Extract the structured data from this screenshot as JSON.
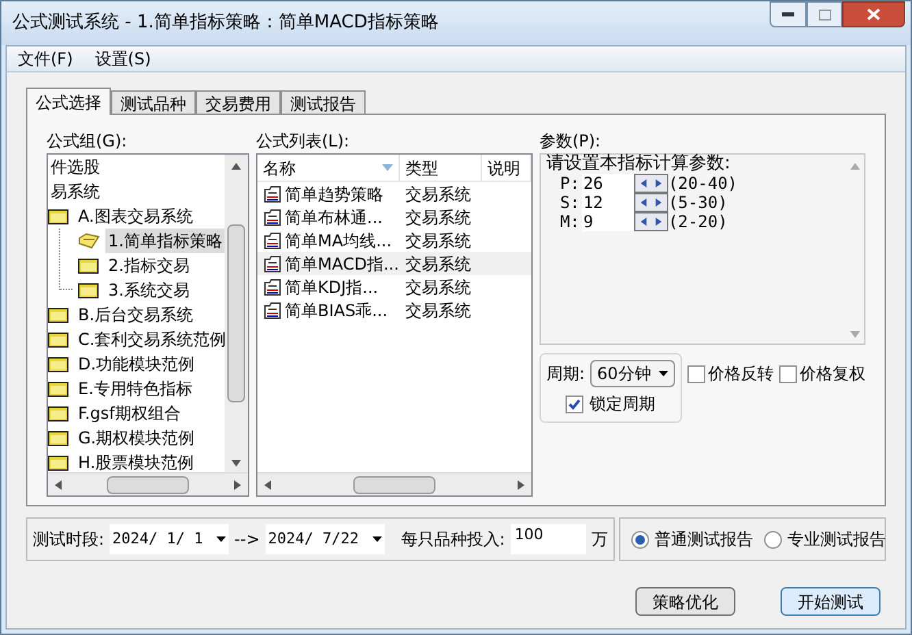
{
  "window": {
    "title": "公式测试系统 - 1.简单指标策略：简单MACD指标策略"
  },
  "menu": [
    "文件(F)",
    "设置(S)"
  ],
  "tabs": [
    {
      "label": "公式选择",
      "selected": true
    },
    {
      "label": "测试品种",
      "selected": false
    },
    {
      "label": "交易费用",
      "selected": false
    },
    {
      "label": "测试报告",
      "selected": false
    }
  ],
  "formula_group": {
    "label": "公式组(G):",
    "items": [
      {
        "kind": "plain",
        "label": "件选股",
        "selected": false
      },
      {
        "kind": "plain",
        "label": "易系统",
        "selected": false
      },
      {
        "kind": "folder",
        "label": "A.图表交易系统",
        "selected": false,
        "expanded": true,
        "children": [
          {
            "kind": "open",
            "label": "1.简单指标策略",
            "selected": true
          },
          {
            "kind": "folder",
            "label": "2.指标交易",
            "selected": false
          },
          {
            "kind": "folder",
            "label": "3.系统交易",
            "selected": false
          }
        ]
      },
      {
        "kind": "folder",
        "label": "B.后台交易系统",
        "selected": false
      },
      {
        "kind": "folder",
        "label": "C.套利交易系统范例",
        "selected": false
      },
      {
        "kind": "folder",
        "label": "D.功能模块范例",
        "selected": false
      },
      {
        "kind": "folder",
        "label": "E.专用特色指标",
        "selected": false
      },
      {
        "kind": "folder",
        "label": "F.gsf期权组合",
        "selected": false
      },
      {
        "kind": "folder",
        "label": "G.期权模块范例",
        "selected": false
      },
      {
        "kind": "folder",
        "label": "H.股票模块范例",
        "selected": false
      }
    ]
  },
  "formula_list": {
    "label": "公式列表(L):",
    "columns": [
      "名称",
      "类型",
      "说明"
    ],
    "rows": [
      {
        "name": "简单趋势策略",
        "type": "交易系统",
        "selected": false
      },
      {
        "name": "简单布林通...",
        "type": "交易系统",
        "selected": false
      },
      {
        "name": "简单MA均线...",
        "type": "交易系统",
        "selected": false
      },
      {
        "name": "简单MACD指...",
        "type": "交易系统",
        "selected": true
      },
      {
        "name": "简单KDJ指...",
        "type": "交易系统",
        "selected": false
      },
      {
        "name": "简单BIAS乖...",
        "type": "交易系统",
        "selected": false
      }
    ]
  },
  "params": {
    "label": "参数(P):",
    "prompt": "请设置本指标计算参数:",
    "rows": [
      {
        "name": "P:",
        "value": "26",
        "range": "(20-40)"
      },
      {
        "name": "S:",
        "value": "12",
        "range": "(5-30)"
      },
      {
        "name": "M:",
        "value": "9",
        "range": "(2-20)"
      }
    ]
  },
  "period": {
    "label": "周期:",
    "value": "60分钟",
    "lock": {
      "label": "锁定周期",
      "checked": true
    }
  },
  "options": [
    {
      "label": "价格反转",
      "checked": false
    },
    {
      "label": "价格复权",
      "checked": false
    }
  ],
  "test_range": {
    "label": "测试时段:",
    "start": "2024/ 1/ 1",
    "arrow": "-->",
    "end": "2024/ 7/22",
    "invest_label": "每只品种投入:",
    "invest": "100",
    "unit": "万"
  },
  "report": [
    {
      "label": "普通测试报告",
      "selected": true
    },
    {
      "label": "专业测试报告",
      "selected": false
    }
  ],
  "buttons": [
    {
      "label": "策略优化",
      "default": false
    },
    {
      "label": "开始测试",
      "default": true
    }
  ]
}
